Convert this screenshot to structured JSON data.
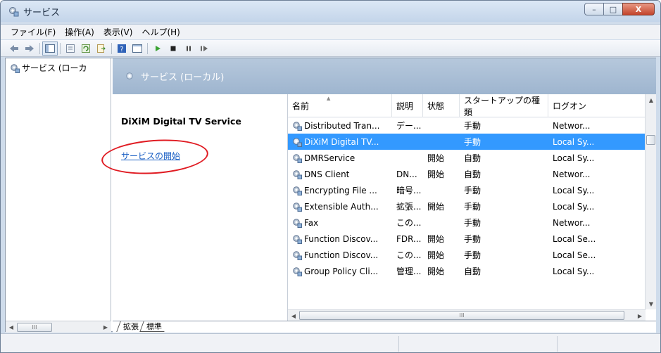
{
  "window": {
    "title": "サービス",
    "buttons": {
      "minimize": "–",
      "maximize": "□",
      "close": "X"
    }
  },
  "menu": [
    "ファイル(F)",
    "操作(A)",
    "表示(V)",
    "ヘルプ(H)"
  ],
  "tree": {
    "node_label": "サービス (ローカ"
  },
  "banner": {
    "title": "サービス (ローカル)"
  },
  "details": {
    "service_name": "DiXiM Digital TV Service",
    "start_link": "サービスの開始"
  },
  "list": {
    "columns": [
      "名前",
      "説明",
      "状態",
      "スタートアップの種類",
      "ログオン"
    ],
    "rows": [
      {
        "name": "Distributed Tran...",
        "desc": "デー...",
        "status": "",
        "startup": "手動",
        "logon": "Networ...",
        "selected": false
      },
      {
        "name": "DiXiM Digital TV...",
        "desc": "",
        "status": "",
        "startup": "手動",
        "logon": "Local Sy...",
        "selected": true
      },
      {
        "name": "DMRService",
        "desc": "",
        "status": "開始",
        "startup": "自動",
        "logon": "Local Sy...",
        "selected": false
      },
      {
        "name": "DNS Client",
        "desc": "DN...",
        "status": "開始",
        "startup": "自動",
        "logon": "Networ...",
        "selected": false
      },
      {
        "name": "Encrypting File ...",
        "desc": "暗号...",
        "status": "",
        "startup": "手動",
        "logon": "Local Sy...",
        "selected": false
      },
      {
        "name": "Extensible Auth...",
        "desc": "拡張...",
        "status": "開始",
        "startup": "手動",
        "logon": "Local Sy...",
        "selected": false
      },
      {
        "name": "Fax",
        "desc": "この...",
        "status": "",
        "startup": "手動",
        "logon": "Networ...",
        "selected": false
      },
      {
        "name": "Function Discov...",
        "desc": "FDR...",
        "status": "開始",
        "startup": "手動",
        "logon": "Local Se...",
        "selected": false
      },
      {
        "name": "Function Discov...",
        "desc": "この...",
        "status": "開始",
        "startup": "手動",
        "logon": "Local Se...",
        "selected": false
      },
      {
        "name": "Group Policy Cli...",
        "desc": "管理...",
        "status": "開始",
        "startup": "自動",
        "logon": "Local Sy...",
        "selected": false
      }
    ],
    "hscroll_grip": "III"
  },
  "tree_hscroll_grip": "III",
  "tabs": [
    "拡張",
    "標準"
  ],
  "colors": {
    "selection": "#3399ff",
    "annotation_circle": "#e01b22",
    "link": "#1a5fc4"
  }
}
